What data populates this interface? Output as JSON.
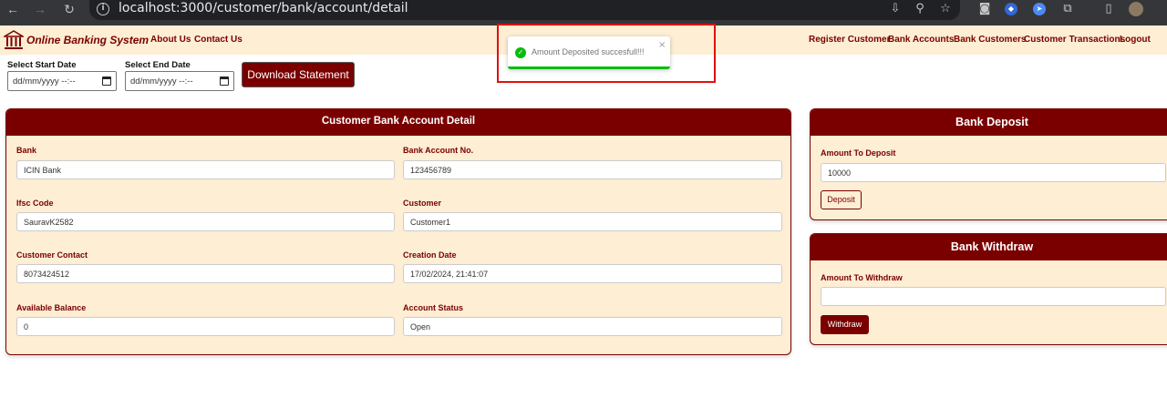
{
  "browser": {
    "url": "localhost:3000/customer/bank/account/detail"
  },
  "navbar": {
    "brand": "Online Banking System",
    "left_links": [
      "About Us",
      "Contact Us"
    ],
    "right_links": [
      "Register Customer",
      "Bank Accounts",
      "Bank Customers",
      "Customer Transactions",
      "Logout"
    ]
  },
  "filters": {
    "start_label": "Select Start Date",
    "end_label": "Select End Date",
    "start_placeholder": "dd/mm/yyyy --:--",
    "end_placeholder": "dd/mm/yyyy --:--",
    "download_label": "Download Statement"
  },
  "toast": {
    "message": "Amount Deposited succesfull!!!",
    "close": "×"
  },
  "account_detail": {
    "title": "Customer Bank Account Detail",
    "fields": [
      {
        "label": "Bank",
        "value": "ICIN Bank"
      },
      {
        "label": "Bank Account No.",
        "value": "123456789"
      },
      {
        "label": "Ifsc Code",
        "value": "SauravK2582"
      },
      {
        "label": "Customer",
        "value": "Customer1"
      },
      {
        "label": "Customer Contact",
        "value": "8073424512"
      },
      {
        "label": "Creation Date",
        "value": "17/02/2024, 21:41:07"
      },
      {
        "label": "Available Balance",
        "value": "0"
      },
      {
        "label": "Account Status",
        "value": "Open"
      }
    ]
  },
  "deposit": {
    "title": "Bank Deposit",
    "label": "Amount To Deposit",
    "value": "10000",
    "button": "Deposit"
  },
  "withdraw": {
    "title": "Bank Withdraw",
    "label": "Amount To Withdraw",
    "value": "",
    "button": "Withdraw"
  },
  "colors": {
    "primary": "#7a0000",
    "background": "#fdeed4",
    "success": "#07bc0c",
    "highlight": "#e01010"
  }
}
